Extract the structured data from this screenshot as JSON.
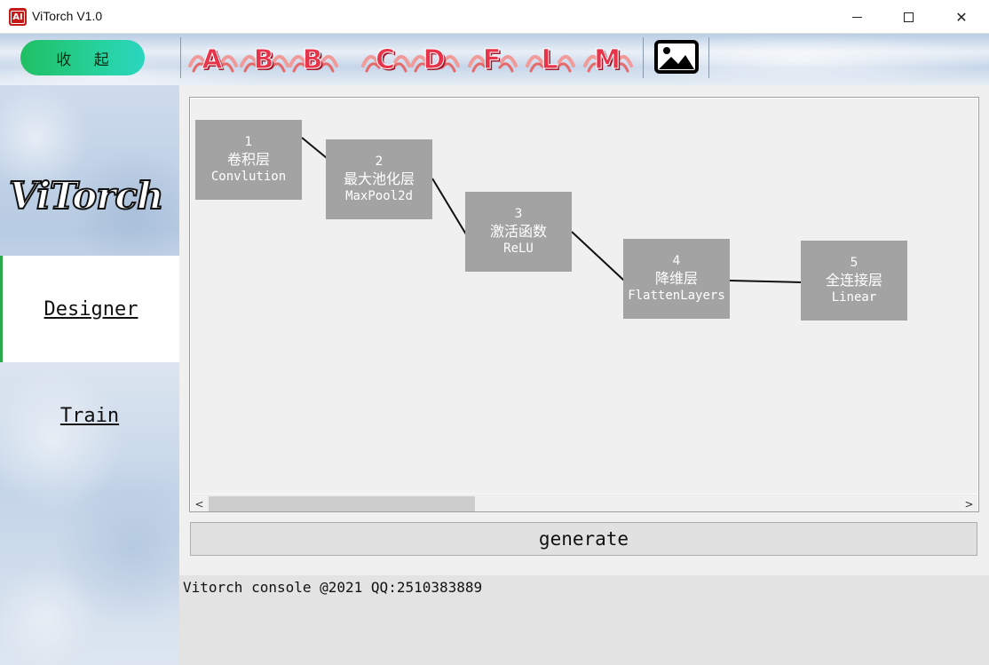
{
  "window": {
    "title": "ViTorch V1.0",
    "icon_text": "AI",
    "minimize_icon": "minimize-icon",
    "maximize_icon": "maximize-icon",
    "close_glyph": "✕"
  },
  "toolbar": {
    "collapse_label": "收 起",
    "collapse_colors": [
      "#1fbf63",
      "#2ad6bf"
    ],
    "layer_buttons": [
      {
        "letter": "A",
        "icon": "letter-a-icon"
      },
      {
        "letter": "B",
        "icon": "letter-b-icon"
      },
      {
        "letter": "B",
        "icon": "letter-b-icon"
      },
      {
        "letter": "C",
        "icon": "letter-c-icon"
      },
      {
        "letter": "D",
        "icon": "letter-d-icon"
      },
      {
        "letter": "F",
        "icon": "letter-f-icon"
      },
      {
        "letter": "L",
        "icon": "letter-l-icon"
      },
      {
        "letter": "M",
        "icon": "letter-m-icon"
      }
    ],
    "letter_color": "#e8344a",
    "image_button_icon": "image-icon"
  },
  "sidebar": {
    "logo_text": "ViTorch",
    "items": [
      {
        "label": "Designer",
        "active": true
      },
      {
        "label": "Train",
        "active": false
      }
    ],
    "active_accent": "#2aa84a"
  },
  "designer": {
    "nodes": [
      {
        "num": "1",
        "cn": "卷积层",
        "en": "Convlution"
      },
      {
        "num": "2",
        "cn": "最大池化层",
        "en": "MaxPool2d"
      },
      {
        "num": "3",
        "cn": "激活函数",
        "en": "ReLU"
      },
      {
        "num": "4",
        "cn": "降维层",
        "en": "FlattenLayers"
      },
      {
        "num": "5",
        "cn": "全连接层",
        "en": "Linear"
      }
    ],
    "node_color": "#a3a3a3",
    "scroll_left": "<",
    "scroll_right": ">"
  },
  "generate_label": "generate",
  "console_text": "Vitorch console @2021 QQ:2510383889"
}
